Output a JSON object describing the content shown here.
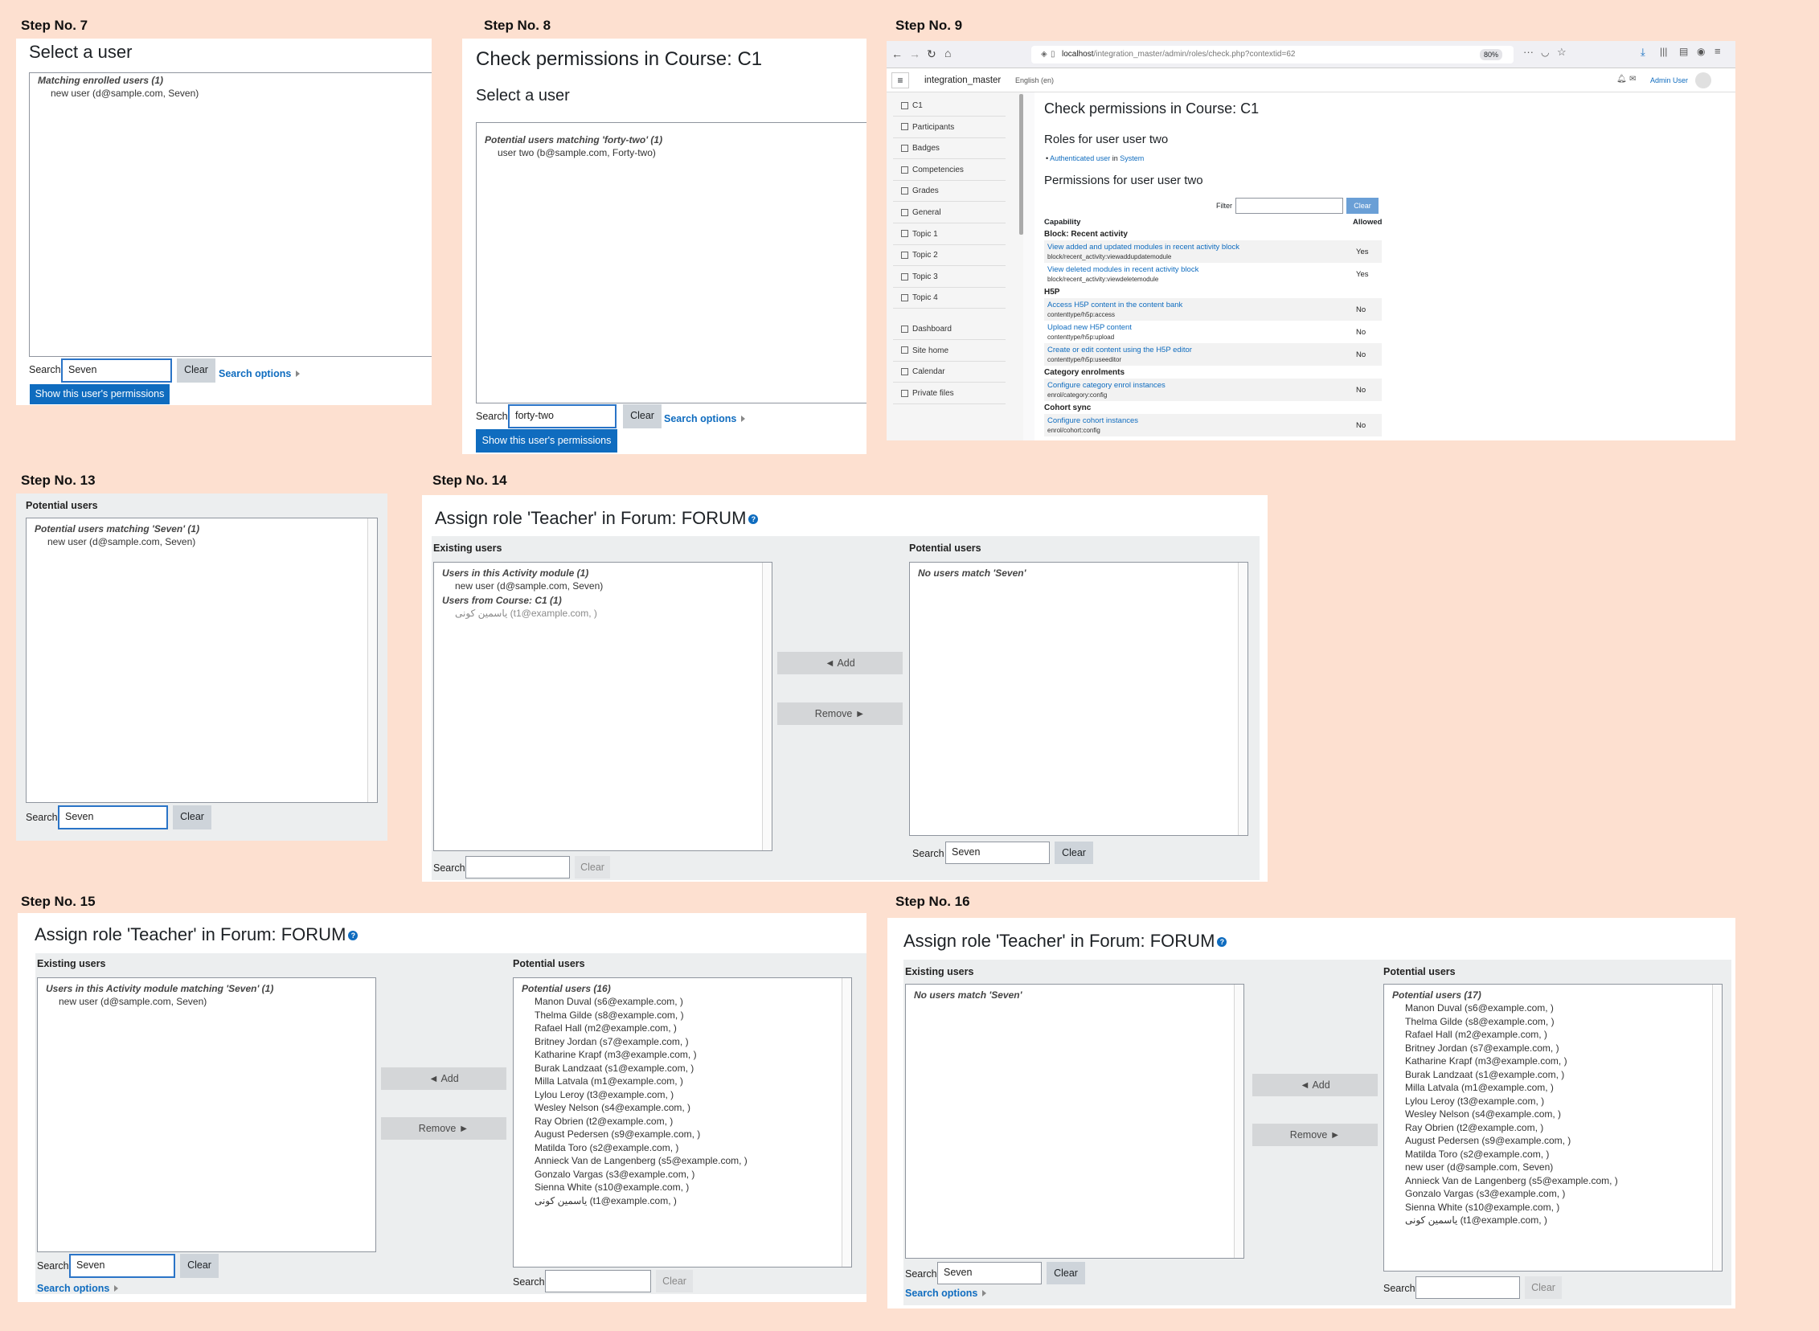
{
  "steps": {
    "s7": {
      "label": "Step No. 7",
      "title": "Select a user",
      "group": "Matching enrolled users (1)",
      "option": "new user (d@sample.com, Seven)",
      "search_label": "Search",
      "search_value": "Seven",
      "clear": "Clear",
      "search_options": "Search options",
      "show_button": "Show this user's permissions"
    },
    "s8": {
      "label": "Step No. 8",
      "title": "Check permissions in Course: C1",
      "subtitle": "Select a user",
      "group": "Potential users matching 'forty-two' (1)",
      "option": "user two (b@sample.com, Forty-two)",
      "search_label": "Search",
      "search_value": "forty-two",
      "clear": "Clear",
      "search_options": "Search options",
      "show_button": "Show this user's permissions"
    },
    "s9": {
      "label": "Step No. 9",
      "url_host": "localhost",
      "url_path": "/integration_master/admin/roles/check.php?contextid=62",
      "zoom": "80%",
      "site_name": "integration_master",
      "language": "English (en)",
      "user": "Admin User",
      "nav": [
        "C1",
        "Participants",
        "Badges",
        "Competencies",
        "Grades",
        "General",
        "Topic 1",
        "Topic 2",
        "Topic 3",
        "Topic 4"
      ],
      "nav2": [
        "Dashboard",
        "Site home",
        "Calendar",
        "Private files"
      ],
      "title": "Check permissions in Course: C1",
      "roles_heading": "Roles for user user two",
      "role_link": "Authenticated user",
      "role_in": "in",
      "role_context": "System",
      "perm_heading": "Permissions for user user two",
      "filter_label": "Filter",
      "clear": "Clear",
      "col_capability": "Capability",
      "col_allowed": "Allowed",
      "cat_block": "Block: Recent activity",
      "cat_h5p": "H5P",
      "cat_enrol": "Category enrolments",
      "cat_cohort": "Cohort sync",
      "rows": [
        {
          "cap": "View added and updated modules in recent activity block",
          "code": "block/recent_activity:viewaddupdatemodule",
          "val": "Yes"
        },
        {
          "cap": "View deleted modules in recent activity block",
          "code": "block/recent_activity:viewdeletemodule",
          "val": "Yes"
        },
        {
          "cap": "Access H5P content in the content bank",
          "code": "contenttype/h5p:access",
          "val": "No"
        },
        {
          "cap": "Upload new H5P content",
          "code": "contenttype/h5p:upload",
          "val": "No"
        },
        {
          "cap": "Create or edit content using the H5P editor",
          "code": "contenttype/h5p:useeditor",
          "val": "No"
        },
        {
          "cap": "Configure category enrol instances",
          "code": "enrol/category:config",
          "val": "No"
        },
        {
          "cap": "Configure cohort instances",
          "code": "enrol/cohort:config",
          "val": "No"
        }
      ]
    },
    "s13": {
      "label": "Step No. 13",
      "heading": "Potential users",
      "group": "Potential users matching 'Seven' (1)",
      "option": "new user (d@sample.com, Seven)",
      "search_label": "Search",
      "search_value": "Seven",
      "clear": "Clear"
    },
    "s14": {
      "label": "Step No. 14",
      "title": "Assign role 'Teacher' in Forum: FORUM",
      "existing": "Existing users",
      "potential": "Potential users",
      "group1": "Users in this Activity module (1)",
      "opt1": "new user (d@sample.com, Seven)",
      "group2": "Users from Course: C1 (1)",
      "opt2": "یاسمین کونی (t1@example.com, )",
      "nomatch": "No users match 'Seven'",
      "add": "◄ Add",
      "remove": "Remove ►",
      "search_label": "Search",
      "search_left": "",
      "search_right": "Seven",
      "clear": "Clear"
    },
    "s15": {
      "label": "Step No. 15",
      "title": "Assign role 'Teacher' in Forum: FORUM",
      "existing": "Existing users",
      "potential": "Potential users",
      "group1": "Users in this Activity module matching 'Seven' (1)",
      "opt1": "new user (d@sample.com, Seven)",
      "pgroup": "Potential users (16)",
      "pusers": [
        "Manon Duval (s6@example.com, )",
        "Thelma Gilde (s8@example.com, )",
        "Rafael Hall (m2@example.com, )",
        "Britney Jordan (s7@example.com, )",
        "Katharine Krapf (m3@example.com, )",
        "Burak Landzaat (s1@example.com, )",
        "Milla Latvala (m1@example.com, )",
        "Lylou Leroy (t3@example.com, )",
        "Wesley Nelson (s4@example.com, )",
        "Ray Obrien (t2@example.com, )",
        "August Pedersen (s9@example.com, )",
        "Matilda Toro (s2@example.com, )",
        "Annieck Van de Langenberg (s5@example.com, )",
        "Gonzalo Vargas (s3@example.com, )",
        "Sienna White (s10@example.com, )",
        "یاسمین کونی (t1@example.com, )"
      ],
      "add": "◄ Add",
      "remove": "Remove ►",
      "search_label": "Search",
      "search_left": "Seven",
      "search_right": "",
      "clear": "Clear",
      "search_options": "Search options"
    },
    "s16": {
      "label": "Step No. 16",
      "title": "Assign role 'Teacher' in Forum: FORUM",
      "existing": "Existing users",
      "potential": "Potential users",
      "nomatch": "No users match 'Seven'",
      "pgroup": "Potential users (17)",
      "pusers": [
        "Manon Duval (s6@example.com, )",
        "Thelma Gilde (s8@example.com, )",
        "Rafael Hall (m2@example.com, )",
        "Britney Jordan (s7@example.com, )",
        "Katharine Krapf (m3@example.com, )",
        "Burak Landzaat (s1@example.com, )",
        "Milla Latvala (m1@example.com, )",
        "Lylou Leroy (t3@example.com, )",
        "Wesley Nelson (s4@example.com, )",
        "Ray Obrien (t2@example.com, )",
        "August Pedersen (s9@example.com, )",
        "Matilda Toro (s2@example.com, )",
        "new user (d@sample.com, Seven)",
        "Annieck Van de Langenberg (s5@example.com, )",
        "Gonzalo Vargas (s3@example.com, )",
        "Sienna White (s10@example.com, )",
        "یاسمین کونی (t1@example.com, )"
      ],
      "add": "◄ Add",
      "remove": "Remove ►",
      "search_label": "Search",
      "search_left": "Seven",
      "search_right": "",
      "clear": "Clear",
      "search_options": "Search options"
    }
  },
  "colors": {
    "background": "#fde0d0",
    "primary": "#0f6cbf",
    "focus": "#2a74c7"
  }
}
